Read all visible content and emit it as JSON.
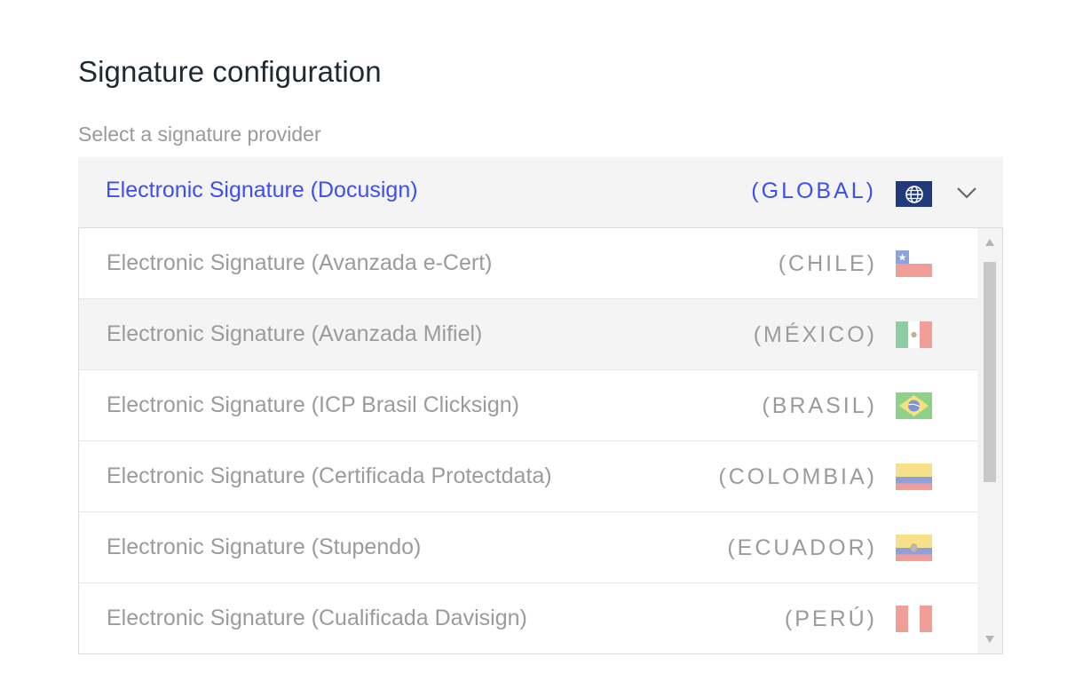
{
  "page": {
    "title": "Signature configuration",
    "field_label": "Select a signature provider"
  },
  "select": {
    "selected_name": "Electronic Signature (Docusign)",
    "selected_region": "(GLOBAL)",
    "flag_icon": "globe-icon",
    "accent_color": "#3d4ff0"
  },
  "options": [
    {
      "name": "Electronic Signature (Avanzada e-Cert)",
      "region": "(CHILE)",
      "flag": "chile-flag-icon"
    },
    {
      "name": "Electronic Signature (Avanzada Mifiel)",
      "region": "(MÉXICO)",
      "flag": "mexico-flag-icon"
    },
    {
      "name": "Electronic Signature (ICP Brasil Clicksign)",
      "region": "(BRASIL)",
      "flag": "brazil-flag-icon"
    },
    {
      "name": "Electronic Signature (Certificada Protectdata)",
      "region": "(COLOMBIA)",
      "flag": "colombia-flag-icon"
    },
    {
      "name": "Electronic Signature (Stupendo)",
      "region": "(ECUADOR)",
      "flag": "ecuador-flag-icon"
    },
    {
      "name": "Electronic Signature (Cualificada Davisign)",
      "region": "(PERÚ)",
      "flag": "peru-flag-icon"
    }
  ]
}
